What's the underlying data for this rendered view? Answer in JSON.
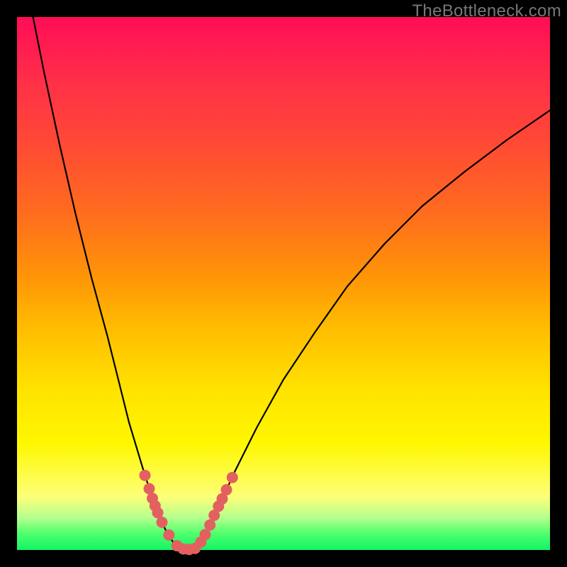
{
  "watermark": "TheBottleneck.com",
  "chart_data": {
    "type": "line",
    "title": "",
    "xlabel": "",
    "ylabel": "",
    "xlim": [
      0,
      100
    ],
    "ylim": [
      0,
      100
    ],
    "legend": null,
    "grid": false,
    "series": [
      {
        "name": "left-curve",
        "x": [
          3,
          5,
          8,
          11,
          14,
          17,
          19,
          21,
          22.5,
          24,
          25.2,
          26.3,
          27.2,
          28,
          28.8,
          29.5,
          30.2,
          31,
          31.8,
          32.5
        ],
        "y": [
          100,
          90,
          76,
          63,
          51,
          40,
          32,
          24,
          19,
          14,
          10.5,
          7.5,
          5.2,
          3.5,
          2.2,
          1.2,
          0.7,
          0.3,
          0.15,
          0.1
        ],
        "approx": true
      },
      {
        "name": "right-curve",
        "x": [
          32.5,
          33.5,
          34.5,
          36,
          38,
          41,
          45,
          50,
          56,
          62,
          69,
          76,
          84,
          92,
          100
        ],
        "y": [
          0.1,
          0.4,
          1.5,
          4,
          8.5,
          15,
          23,
          32,
          41,
          49.5,
          57.5,
          64.5,
          71,
          77,
          82.5
        ],
        "approx": true
      }
    ],
    "markers": {
      "name": "bead-markers",
      "color": "#e36060",
      "clusters": [
        {
          "x": 24.0,
          "y": 14.0
        },
        {
          "x": 24.8,
          "y": 11.5
        },
        {
          "x": 25.4,
          "y": 9.7
        },
        {
          "x": 25.9,
          "y": 8.3
        },
        {
          "x": 26.4,
          "y": 7.0
        },
        {
          "x": 27.2,
          "y": 5.2
        },
        {
          "x": 28.5,
          "y": 2.8
        },
        {
          "x": 30.0,
          "y": 0.8
        },
        {
          "x": 31.2,
          "y": 0.2
        },
        {
          "x": 32.3,
          "y": 0.1
        },
        {
          "x": 33.4,
          "y": 0.3
        },
        {
          "x": 34.5,
          "y": 1.5
        },
        {
          "x": 35.3,
          "y": 2.9
        },
        {
          "x": 36.2,
          "y": 4.7
        },
        {
          "x": 37.0,
          "y": 6.5
        },
        {
          "x": 37.8,
          "y": 8.2
        },
        {
          "x": 38.5,
          "y": 9.6
        },
        {
          "x": 39.3,
          "y": 11.3
        },
        {
          "x": 40.4,
          "y": 13.6
        }
      ],
      "approx": true
    },
    "gradient_stops": [
      {
        "pos": 0.0,
        "color": "#ff0d57"
      },
      {
        "pos": 0.5,
        "color": "#ff9208"
      },
      {
        "pos": 0.8,
        "color": "#fff700"
      },
      {
        "pos": 1.0,
        "color": "#12f466"
      }
    ]
  }
}
